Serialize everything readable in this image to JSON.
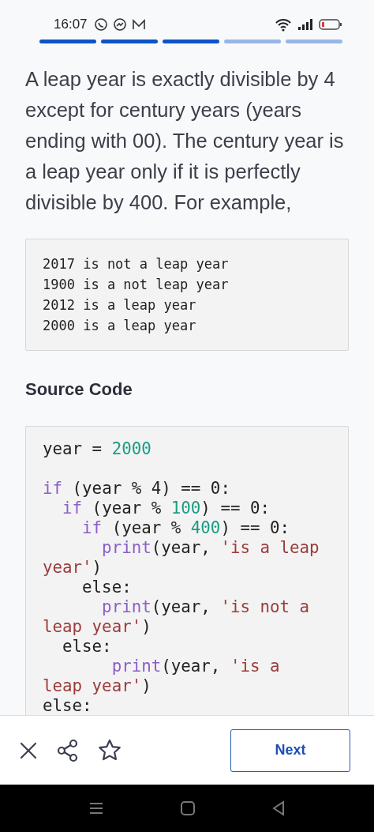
{
  "status_bar": {
    "time": "16:07"
  },
  "progress": [
    {
      "completed": true
    },
    {
      "completed": true
    },
    {
      "completed": true
    },
    {
      "completed": false
    },
    {
      "completed": false
    }
  ],
  "paragraph": "A leap year is exactly divisible by 4 except for century years (years ending with 00). The century year is a leap year only if it is perfectly divisible by 400. For example,",
  "example_lines": [
    "2017 is not a leap year",
    "1900 is a not leap year",
    "2012 is a leap year",
    "2000 is a leap year"
  ],
  "heading": "Source Code",
  "code_lines": [
    {
      "gap_before": false,
      "tokens": [
        {
          "kind": "plain",
          "text": "year = "
        },
        {
          "kind": "number",
          "text": "2000"
        }
      ]
    },
    {
      "gap_before": true,
      "tokens": [
        {
          "kind": "keyword",
          "text": "if"
        },
        {
          "kind": "plain",
          "text": " (year % 4) == 0:"
        }
      ]
    },
    {
      "gap_before": false,
      "tokens": [
        {
          "kind": "keyword",
          "text": "  if"
        },
        {
          "kind": "plain",
          "text": " (year % "
        },
        {
          "kind": "number",
          "text": "100"
        },
        {
          "kind": "plain",
          "text": ") == 0:"
        }
      ]
    },
    {
      "gap_before": false,
      "tokens": [
        {
          "kind": "keyword",
          "text": "    if"
        },
        {
          "kind": "plain",
          "text": " (year % "
        },
        {
          "kind": "number",
          "text": "400"
        },
        {
          "kind": "plain",
          "text": ") == 0:"
        }
      ]
    },
    {
      "gap_before": false,
      "tokens": [
        {
          "kind": "keyword",
          "text": "      print"
        },
        {
          "kind": "plain",
          "text": "(year, "
        },
        {
          "kind": "string",
          "text": "'is a leap"
        }
      ]
    },
    {
      "gap_before": false,
      "tokens": [
        {
          "kind": "string",
          "text": "year'"
        },
        {
          "kind": "plain",
          "text": ")"
        }
      ]
    },
    {
      "gap_before": false,
      "tokens": [
        {
          "kind": "plain",
          "text": "    else:"
        }
      ]
    },
    {
      "gap_before": false,
      "tokens": [
        {
          "kind": "keyword",
          "text": "      print"
        },
        {
          "kind": "plain",
          "text": "(year, "
        },
        {
          "kind": "string",
          "text": "'is not a"
        }
      ]
    },
    {
      "gap_before": false,
      "tokens": [
        {
          "kind": "string",
          "text": "leap year'"
        },
        {
          "kind": "plain",
          "text": ")"
        }
      ]
    },
    {
      "gap_before": false,
      "tokens": [
        {
          "kind": "plain",
          "text": "  else:"
        }
      ]
    },
    {
      "gap_before": false,
      "tokens": [
        {
          "kind": "keyword",
          "text": "       print"
        },
        {
          "kind": "plain",
          "text": "(year, "
        },
        {
          "kind": "string",
          "text": "'is a"
        }
      ]
    },
    {
      "gap_before": false,
      "tokens": [
        {
          "kind": "string",
          "text": "leap year'"
        },
        {
          "kind": "plain",
          "text": ")"
        }
      ]
    },
    {
      "gap_before": false,
      "tokens": [
        {
          "kind": "plain",
          "text": "else:"
        }
      ]
    }
  ],
  "bottom_bar": {
    "next_button": "Next"
  }
}
